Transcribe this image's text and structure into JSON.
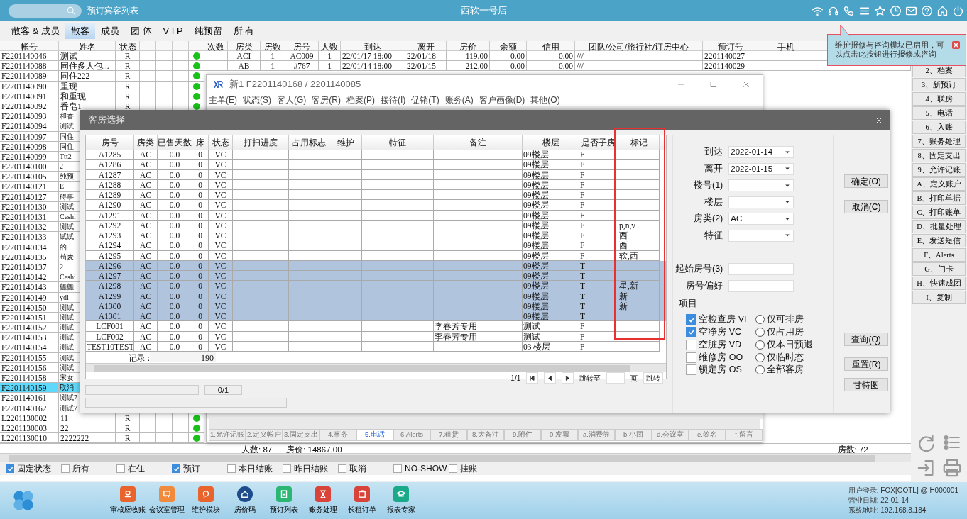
{
  "top_bar": {
    "page_title": "预订宾客列表",
    "hotel": "西软一号店"
  },
  "tabs": [
    {
      "label": "散客 & 成员",
      "selected": false
    },
    {
      "label": "散客",
      "selected": true
    },
    {
      "label": "成员",
      "selected": false
    },
    {
      "label": "团 体",
      "selected": false
    },
    {
      "label": "V I P",
      "selected": false
    },
    {
      "label": "纯预留",
      "selected": false
    },
    {
      "label": "所 有",
      "selected": false
    }
  ],
  "guest_list": {
    "columns": [
      "帐号",
      "姓名",
      "状态",
      "-",
      "-",
      "-",
      "-",
      "次数",
      "房类",
      "房数",
      "房号",
      "人数",
      "到达",
      "离开",
      "房价",
      "余额",
      "信用",
      "团队/公司/旅行社/订房中心",
      "预订号",
      "手机"
    ],
    "rows": [
      {
        "account": "F2201140046",
        "name": "测试",
        "status": "R",
        "dot": true,
        "selected": false,
        "cols": [
          "ACI",
          "1",
          "AC009",
          "1",
          "22/01/17 18:00",
          "22/01/18",
          "119.00",
          "0.00",
          "0.00",
          "///",
          "2201140027"
        ]
      },
      {
        "account": "F2201140088",
        "name": "同住多人包...",
        "status": "R",
        "dot": true,
        "selected": false,
        "cols": [
          "AB",
          "1",
          "#767",
          "1",
          "22/01/14 18:00",
          "22/01/15",
          "212.00",
          "0.00",
          "0.00",
          "///",
          "2201140029"
        ]
      },
      {
        "account": "F2201140089",
        "name": "同住222",
        "status": "R",
        "dot": true,
        "selected": false
      },
      {
        "account": "F2201140090",
        "name": "重现",
        "status": "R",
        "dot": true,
        "selected": false
      },
      {
        "account": "F2201140091",
        "name": "和重现",
        "status": "R",
        "dot": true,
        "selected": false
      },
      {
        "account": "F2201140092",
        "name": "香皂1",
        "status": "R",
        "dot": true,
        "selected": false
      },
      {
        "account": "F2201140093",
        "name": "和香",
        "selected": false
      },
      {
        "account": "F2201140094",
        "name": "测试",
        "selected": false
      },
      {
        "account": "F2201140097",
        "name": "同住",
        "selected": false
      },
      {
        "account": "F2201140098",
        "name": "同住",
        "selected": false
      },
      {
        "account": "F2201140099",
        "name": "Ttt2",
        "selected": false
      },
      {
        "account": "F2201140100",
        "name": "2",
        "selected": false
      },
      {
        "account": "F2201140105",
        "name": "纯预",
        "selected": false
      },
      {
        "account": "F2201140121",
        "name": "E",
        "selected": false
      },
      {
        "account": "F2201140127",
        "name": "碍事",
        "selected": false
      },
      {
        "account": "F2201140130",
        "name": "测试",
        "selected": false
      },
      {
        "account": "F2201140131",
        "name": "Ceshi",
        "selected": false
      },
      {
        "account": "F2201140132",
        "name": "测试",
        "selected": false
      },
      {
        "account": "F2201140133",
        "name": "试试",
        "selected": false
      },
      {
        "account": "F2201140134",
        "name": "的",
        "selected": false
      },
      {
        "account": "F2201140135",
        "name": "苟麦",
        "selected": false
      },
      {
        "account": "F2201140137",
        "name": "2",
        "selected": false
      },
      {
        "account": "F2201140142",
        "name": "Ceshi",
        "selected": false
      },
      {
        "account": "F2201140143",
        "name": "龘龘",
        "selected": false
      },
      {
        "account": "F2201140149",
        "name": "ydl",
        "selected": false
      },
      {
        "account": "F2201140150",
        "name": "测试",
        "selected": false
      },
      {
        "account": "F2201140151",
        "name": "测试",
        "selected": false
      },
      {
        "account": "F2201140152",
        "name": "测试",
        "selected": false
      },
      {
        "account": "F2201140153",
        "name": "测试",
        "selected": false
      },
      {
        "account": "F2201140154",
        "name": "测试",
        "selected": false
      },
      {
        "account": "F2201140155",
        "name": "测试",
        "selected": false
      },
      {
        "account": "F2201140156",
        "name": "测试",
        "selected": false
      },
      {
        "account": "F2201140158",
        "name": "宋女",
        "selected": false
      },
      {
        "account": "F2201140159",
        "name": "取消",
        "selected": true
      },
      {
        "account": "F2201140161",
        "name": "测试7",
        "selected": false
      },
      {
        "account": "F2201140162",
        "name": "测试7",
        "selected": false
      },
      {
        "account": "L2201130002",
        "name": "11",
        "status": "R",
        "dot": true,
        "selected": false
      },
      {
        "account": "L2201130003",
        "name": "22",
        "status": "R",
        "dot": true,
        "selected": false
      },
      {
        "account": "L2201130010",
        "name": "2222222",
        "status": "R",
        "dot": true,
        "selected": false
      }
    ],
    "totals": {
      "guests": "人数: 87",
      "rate": "房价: 14867.00",
      "rooms": "房数: 72"
    }
  },
  "filters": [
    {
      "label": "固定状态",
      "checked": true
    },
    {
      "label": "所有",
      "checked": false
    },
    {
      "label": "在住",
      "checked": false
    },
    {
      "label": "预订",
      "checked": true
    },
    {
      "label": "本日结账",
      "checked": false
    },
    {
      "label": "昨日结账",
      "checked": false
    },
    {
      "label": "取消",
      "checked": false
    },
    {
      "label": "NO-SHOW",
      "checked": false
    },
    {
      "label": "挂账",
      "checked": false
    }
  ],
  "side_buttons": [
    "2、档案",
    "3、新预订",
    "4、联房",
    "5、电话",
    "6、入账",
    "7、账务处理",
    "8、固定支出",
    "9、允许记账",
    "A、定义账户",
    "B、打印单据",
    "C、打印账单",
    "D、批量处理",
    "E、发送短信",
    "F、Alerts",
    "G、门卡",
    "H、快速成团",
    "I、复制"
  ],
  "tooltip": {
    "text": "维护报修与咨询模块已启用，可以点击此按钮进行报修或咨询"
  },
  "order_window": {
    "title": "新1  F2201140168 / 2201140085",
    "menu": [
      "主单(E)",
      "状态(S)",
      "客人(G)",
      "客房(R)",
      "档案(P)",
      "接待(I)",
      "促销(T)",
      "账务(A)",
      "客户画像(D)",
      "其他(O)"
    ],
    "tabs": [
      {
        "label": "1.允许记账",
        "selected": false
      },
      {
        "label": "2.定义帐户",
        "selected": false
      },
      {
        "label": "3.固定支出",
        "selected": false
      },
      {
        "label": "4.事务",
        "selected": false
      },
      {
        "label": "5.电话",
        "selected": true
      },
      {
        "label": "6.Alerts",
        "selected": false
      },
      {
        "label": "7.租赁",
        "selected": false
      },
      {
        "label": "8.大备注",
        "selected": false
      },
      {
        "label": "9.附件",
        "selected": false
      },
      {
        "label": "0.发票",
        "selected": false
      },
      {
        "label": "a.消费券",
        "selected": false
      },
      {
        "label": "b.小团",
        "selected": false
      },
      {
        "label": "d.会议室",
        "selected": false
      },
      {
        "label": "e.签名",
        "selected": false
      },
      {
        "label": "f.留言",
        "selected": false
      }
    ]
  },
  "room_dialog": {
    "title": "客房选择",
    "columns": [
      "房号",
      "房类",
      "已售天数",
      "床",
      "状态",
      "打扫进度",
      "占用标志",
      "维护",
      "特征",
      "备注",
      "楼层",
      "是否子房",
      "标记"
    ],
    "rows": [
      {
        "room": "A1285",
        "type": "AC",
        "days": "0.0",
        "bed": "0",
        "status": "VC",
        "floor": "09楼层",
        "sub": "F",
        "selected": false
      },
      {
        "room": "A1286",
        "type": "AC",
        "days": "0.0",
        "bed": "0",
        "status": "VC",
        "floor": "09楼层",
        "sub": "F",
        "selected": false
      },
      {
        "room": "A1287",
        "type": "AC",
        "days": "0.0",
        "bed": "0",
        "status": "VC",
        "floor": "09楼层",
        "sub": "F",
        "selected": false
      },
      {
        "room": "A1288",
        "type": "AC",
        "days": "0.0",
        "bed": "0",
        "status": "VC",
        "floor": "09楼层",
        "sub": "F",
        "selected": false
      },
      {
        "room": "A1289",
        "type": "AC",
        "days": "0.0",
        "bed": "0",
        "status": "VC",
        "floor": "09楼层",
        "sub": "F",
        "selected": false
      },
      {
        "room": "A1290",
        "type": "AC",
        "days": "0.0",
        "bed": "0",
        "status": "VC",
        "floor": "09楼层",
        "sub": "F",
        "selected": false
      },
      {
        "room": "A1291",
        "type": "AC",
        "days": "0.0",
        "bed": "0",
        "status": "VC",
        "floor": "09楼层",
        "sub": "F",
        "selected": false
      },
      {
        "room": "A1292",
        "type": "AC",
        "days": "0.0",
        "bed": "0",
        "status": "VC",
        "floor": "09楼层",
        "sub": "F",
        "mark": "p,n,v",
        "selected": false
      },
      {
        "room": "A1293",
        "type": "AC",
        "days": "0.0",
        "bed": "0",
        "status": "VC",
        "floor": "09楼层",
        "sub": "F",
        "mark": "西",
        "selected": false
      },
      {
        "room": "A1294",
        "type": "AC",
        "days": "0.0",
        "bed": "0",
        "status": "VC",
        "floor": "09楼层",
        "sub": "F",
        "mark": "西",
        "selected": false
      },
      {
        "room": "A1295",
        "type": "AC",
        "days": "0.0",
        "bed": "0",
        "status": "VC",
        "floor": "09楼层",
        "sub": "F",
        "mark": "软,西",
        "selected": false
      },
      {
        "room": "A1296",
        "type": "AC",
        "days": "0.0",
        "bed": "0",
        "status": "VC",
        "floor": "09楼层",
        "sub": "T",
        "selected": true
      },
      {
        "room": "A1297",
        "type": "AC",
        "days": "0.0",
        "bed": "0",
        "status": "VC",
        "floor": "09楼层",
        "sub": "T",
        "selected": true
      },
      {
        "room": "A1298",
        "type": "AC",
        "days": "0.0",
        "bed": "0",
        "status": "VC",
        "floor": "09楼层",
        "sub": "T",
        "mark": "星,新",
        "selected": true
      },
      {
        "room": "A1299",
        "type": "AC",
        "days": "0.0",
        "bed": "0",
        "status": "VC",
        "floor": "09楼层",
        "sub": "T",
        "mark": "新",
        "selected": true
      },
      {
        "room": "A1300",
        "type": "AC",
        "days": "0.0",
        "bed": "0",
        "status": "VC",
        "floor": "09楼层",
        "sub": "T",
        "mark": "新",
        "selected": true
      },
      {
        "room": "A1301",
        "type": "AC",
        "days": "0.0",
        "bed": "0",
        "status": "VC",
        "floor": "09楼层",
        "sub": "T",
        "selected": true
      },
      {
        "room": "LCF001",
        "type": "AC",
        "days": "0.0",
        "bed": "0",
        "status": "VC",
        "remark": "李春芳专用",
        "floor": "测试",
        "sub": "F",
        "selected": false
      },
      {
        "room": "LCF002",
        "type": "AC",
        "days": "0.0",
        "bed": "0",
        "status": "VC",
        "remark": "李春芳专用",
        "floor": "测试",
        "sub": "F",
        "selected": false
      },
      {
        "room": "TEST10TEST",
        "type": "AC",
        "days": "0.0",
        "bed": "0",
        "status": "VC",
        "floor": "03 楼层",
        "sub": "F",
        "selected": false
      }
    ],
    "record_label": "记录 :",
    "record_count": "190",
    "pager": {
      "page": "1/1",
      "goto_label": "跳转至",
      "page_unit": "页",
      "goto_button": "跳转"
    },
    "progress": "0/1",
    "annotation": {
      "kind": "frame"
    },
    "form": [
      {
        "label": "到达",
        "kind": "select",
        "value": "2022-01-14"
      },
      {
        "label": "离开",
        "kind": "select",
        "value": "2022-01-15"
      },
      {
        "label": "楼号(1)",
        "kind": "select"
      },
      {
        "label": "楼层",
        "kind": "select"
      },
      {
        "label": "房类(2)",
        "kind": "select",
        "value": "AC"
      },
      {
        "label": "特征",
        "kind": "select"
      },
      {
        "label": "起始房号(3)",
        "kind": "input"
      },
      {
        "label": "房号偏好",
        "kind": "input"
      }
    ],
    "items_label": "项目",
    "checks": [
      {
        "label": "空检查房 VI",
        "checked": true
      },
      {
        "label": "空净房 VC",
        "checked": true
      },
      {
        "label": "空脏房 VD",
        "checked": false
      },
      {
        "label": "维修房 OO",
        "checked": false
      },
      {
        "label": "锁定房 OS",
        "checked": false
      }
    ],
    "radios": [
      {
        "label": "仅可排房",
        "selected": false
      },
      {
        "label": "仅占用房",
        "selected": false
      },
      {
        "label": "仅本日预退",
        "selected": false
      },
      {
        "label": "仅临时态",
        "selected": false
      },
      {
        "label": "全部客房",
        "selected": false
      }
    ],
    "buttons_top": [
      "确定(O)",
      "取消(C)"
    ],
    "buttons_bottom": [
      "查询(Q)",
      "重置(R)",
      "甘特图"
    ]
  },
  "taskbar": {
    "apps": [
      {
        "label": "审核应收账",
        "color": "#e8642c"
      },
      {
        "label": "会议室管理",
        "color": "#f08a3c"
      },
      {
        "label": "维护模块",
        "color": "#e8642c"
      },
      {
        "label": "房价码",
        "color": "#1e4c8a"
      },
      {
        "label": "预订列表",
        "color": "#2bb673"
      },
      {
        "label": "账务处理",
        "color": "#d9443a"
      },
      {
        "label": "长租订单",
        "color": "#d9443a"
      },
      {
        "label": "报表专家",
        "color": "#1aaa8a"
      }
    ],
    "info": [
      "用户登录: FOX[OOTL] @ H000001",
      "营业日期: 22-01-14",
      "系统地址: 192.168.8.184"
    ]
  }
}
